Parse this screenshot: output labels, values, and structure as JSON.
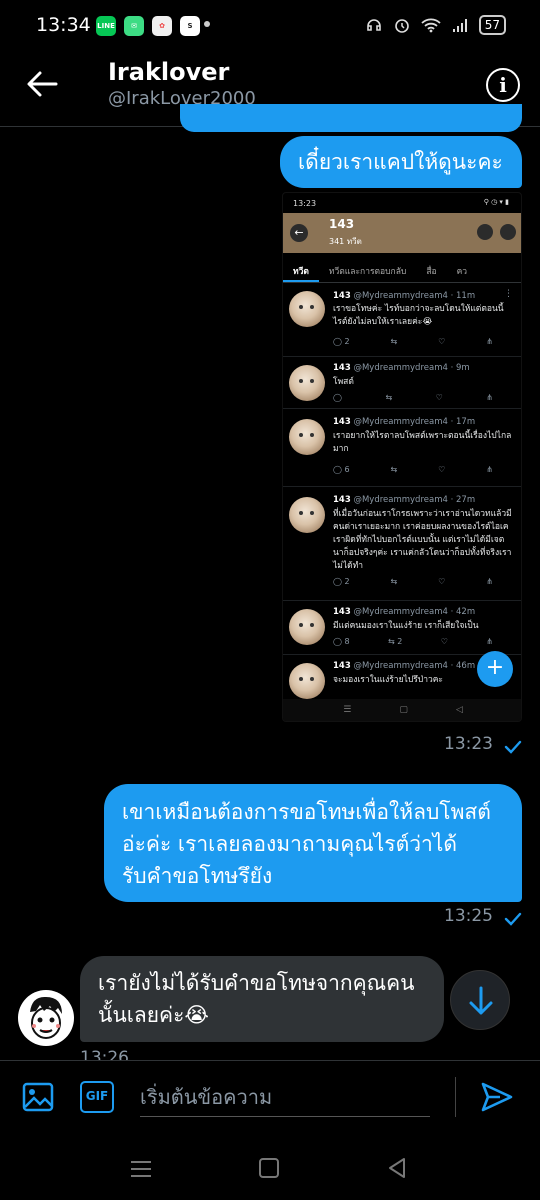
{
  "status_bar": {
    "time": "13:34",
    "battery": "57"
  },
  "header": {
    "name": "Iraklover",
    "handle": "@IrakLover2000"
  },
  "messages": {
    "out1": "เดี๋ยวเราแคปให้ดูนะคะ",
    "out1_time": "13:23",
    "out2": "เขาเหมือนต้องการขอโทษเพื่อให้ลบโพสต์อ่ะค่ะ เราเลยลองมาถามคุณไรต์ว่าได้รับคำขอโทษรึยัง",
    "out2_time": "13:25",
    "in1": "เรายังไม่ได้รับคำขอโทษจากคุณคนนั้นเลยค่ะ😭",
    "in1_time": "13:26"
  },
  "screenshot": {
    "time": "13:23",
    "title": "143",
    "subtitle": "341 ทวีต",
    "tabs": [
      "ทวีต",
      "ทวีตและการตอบกลับ",
      "สื่อ",
      "คว"
    ],
    "tweets": [
      {
        "name": "143",
        "handle": "@Mydreammydream4",
        "time": "11m",
        "text": "เราขอโทษค่ะ ไรท์บอกว่าจะลบโดนให้แต่ตอนนี้ไรต์ยังไม่ลบให้เราเลยค่ะ😭",
        "replies": "2",
        "rts": "",
        "likes": ""
      },
      {
        "name": "143",
        "handle": "@Mydreammydream4",
        "time": "9m",
        "text": "โพสต์",
        "replies": "",
        "rts": "",
        "likes": ""
      },
      {
        "name": "143",
        "handle": "@Mydreammydream4",
        "time": "17m",
        "text": "เราอยากให้ไรตาลบโพสต์เพราะตอนนี้เรื่องไปไกลมาก",
        "replies": "6",
        "rts": "",
        "likes": ""
      },
      {
        "name": "143",
        "handle": "@Mydreammydream4",
        "time": "27m",
        "text": "ที่เมื่อวันก่อนเราโกรธเพราะว่าเราอ่านไดวทแล้วมีคนด่าเราเยอะมาก เราค่อยบผลงานของไรต์ไอเค เราผิดที่ทักไปบอกไรต์แบบนั้น แต่เราไม่ได้มีเจตนาก็อปจริงๆค่ะ เราแค่กลัวโดนว่าก็อปทั้งที่จริงเราไม่ได้ทำ",
        "replies": "2",
        "rts": "",
        "likes": ""
      },
      {
        "name": "143",
        "handle": "@Mydreammydream4",
        "time": "42m",
        "text": "มีแต่คนมองเราในแง่ร้าย เราก็เสียใจเป็น",
        "replies": "8",
        "rts": "2",
        "likes": ""
      },
      {
        "name": "143",
        "handle": "@Mydreammydream4",
        "time": "46m",
        "text": "จะมองเราในแง่ร้ายไปรึป่าวคะ",
        "replies": "",
        "rts": "",
        "likes": ""
      }
    ]
  },
  "composer": {
    "placeholder": "เริ่มต้นข้อความ",
    "gif_label": "GIF"
  },
  "colors": {
    "accent": "#1d9bf0",
    "bg": "#000000",
    "incoming": "#2f3336"
  }
}
